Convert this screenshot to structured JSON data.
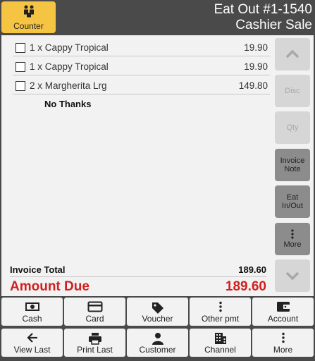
{
  "header": {
    "counter_label": "Counter",
    "title_line1": "Eat Out #1-1540",
    "title_line2": "Cashier Sale"
  },
  "order": {
    "items": [
      {
        "desc": "1 x Cappy Tropical",
        "price": "19.90"
      },
      {
        "desc": "1 x Cappy Tropical",
        "price": "19.90"
      },
      {
        "desc": "2 x Margherita Lrg",
        "price": "149.80"
      }
    ],
    "note": "No Thanks",
    "invoice_total_label": "Invoice Total",
    "invoice_total_value": "189.60",
    "amount_due_label": "Amount Due",
    "amount_due_value": "189.60"
  },
  "side": {
    "disc": "Disc",
    "qty": "Qty",
    "invoice_note_1": "Invoice",
    "invoice_note_2": "Note",
    "eat_inout_1": "Eat",
    "eat_inout_2": "In/Out",
    "more": "More"
  },
  "actions": {
    "cash": "Cash",
    "card": "Card",
    "voucher": "Voucher",
    "other_pmt": "Other pmt",
    "account": "Account",
    "view_last": "View Last",
    "print_last": "Print Last",
    "customer": "Customer",
    "channel": "Channel",
    "more": "More"
  },
  "colors": {
    "accent": "#f6c443",
    "amount_due": "#d21f1f",
    "background": "#4a4a4a",
    "panel": "#f2f2f2"
  }
}
